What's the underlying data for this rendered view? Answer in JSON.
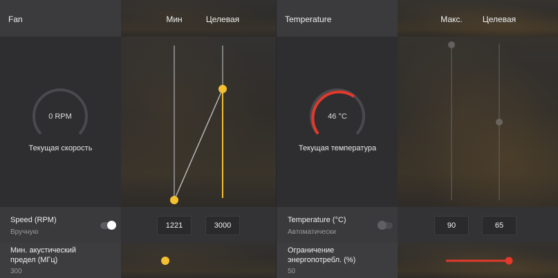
{
  "fan": {
    "title": "Fan",
    "col_min": "Мин",
    "col_target": "Целевая",
    "gauge_value": "0 RPM",
    "gauge_label": "Текущая скорость",
    "speed_label": "Speed (RPM)",
    "speed_mode": "Вручную",
    "min_value": "1221",
    "target_value": "3000",
    "acoustic_label_line1": "Мин. акустический",
    "acoustic_label_line2": "предел (МГц)",
    "acoustic_value": "300"
  },
  "temperature": {
    "title": "Temperature",
    "col_max": "Макс.",
    "col_target": "Целевая",
    "gauge_value": "46 °C",
    "gauge_label": "Текущая температура",
    "temp_label": "Temperature (°C)",
    "temp_mode": "Автоматически",
    "max_value": "90",
    "target_value": "65",
    "power_label_line1": "Ограничение",
    "power_label_line2": "энергопотребл. (%)",
    "power_value": "50"
  },
  "colors": {
    "accent_yellow": "#f5c02f",
    "accent_red": "#e2392b",
    "gauge_track": "#4a4a4e"
  }
}
